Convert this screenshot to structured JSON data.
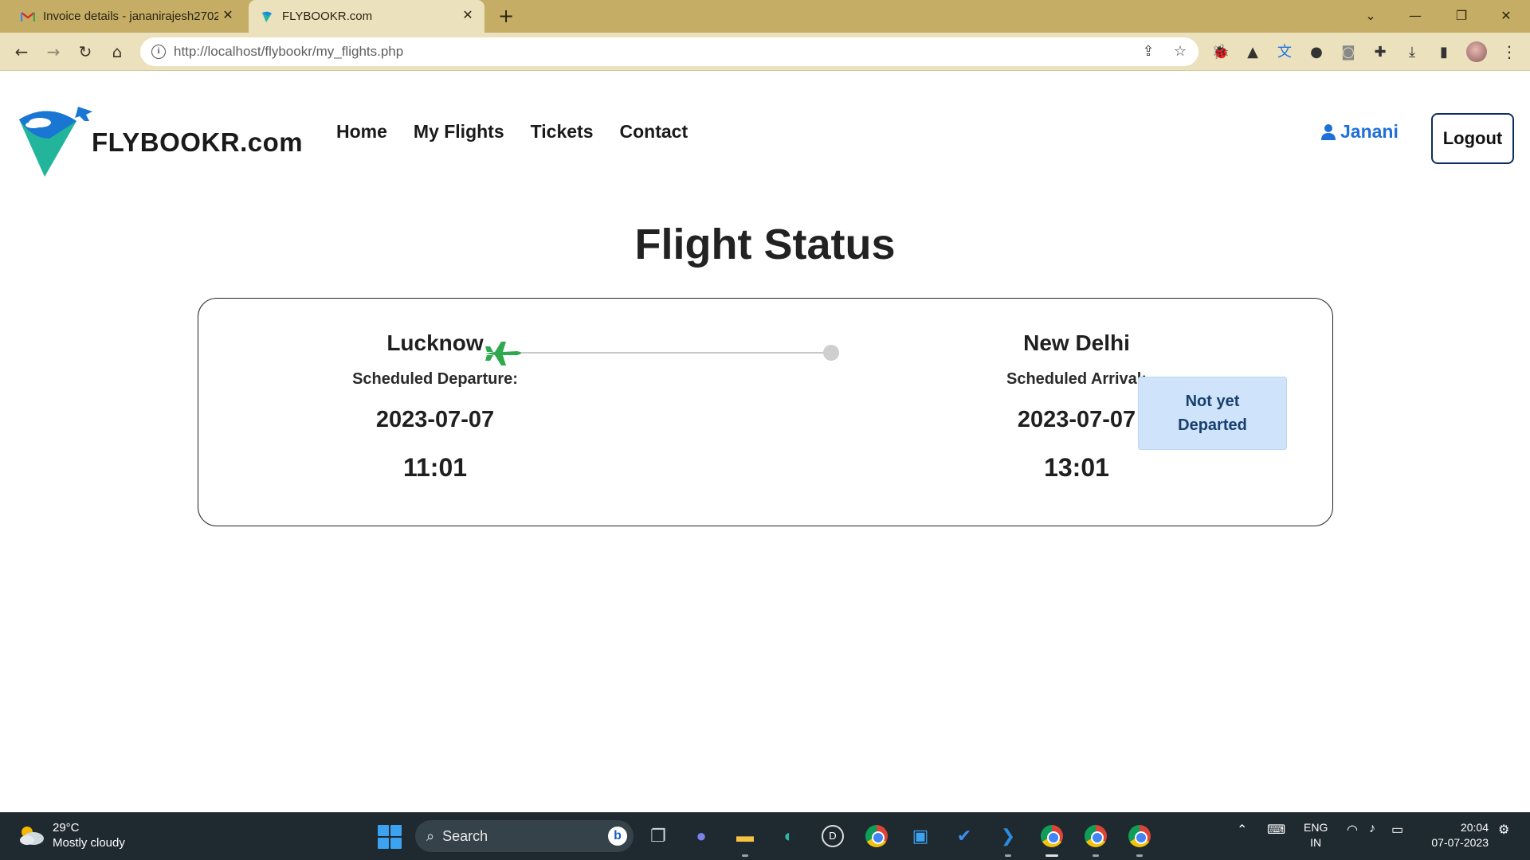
{
  "browser": {
    "tabs": [
      {
        "title": "Invoice details - jananirajesh2702",
        "icon": "gmail-icon",
        "active": false
      },
      {
        "title": "FLYBOOKR.com",
        "icon": "flybookr-favicon",
        "active": true
      }
    ],
    "new_tab_symbol": "+",
    "url": "http://localhost/flybookr/my_flights.php",
    "window_controls": {
      "dropdown": "⌄",
      "minimize": "—",
      "restore": "❐",
      "close": "✕"
    }
  },
  "site": {
    "brand": "FLYBOOKR.com",
    "nav": [
      "Home",
      "My Flights",
      "Tickets",
      "Contact"
    ],
    "user_name": "Janani",
    "logout_label": "Logout"
  },
  "page": {
    "title": "Flight Status"
  },
  "flight": {
    "departure": {
      "city": "Lucknow",
      "label": "Scheduled Departure:",
      "date": "2023-07-07",
      "time": "11:01"
    },
    "arrival": {
      "city": "New Delhi",
      "label": "Scheduled Arrival:",
      "date": "2023-07-07",
      "time": "13:01"
    },
    "status": "Not yet Departed",
    "progress": 0,
    "colors": {
      "plane": "#2fa84f",
      "status_bg": "#cfe4fa",
      "status_text": "#17406e",
      "user_link": "#1e6fd9"
    }
  },
  "taskbar": {
    "weather": {
      "temp": "29°C",
      "condition": "Mostly cloudy"
    },
    "search_placeholder": "Search",
    "language": {
      "line1": "ENG",
      "line2": "IN"
    },
    "clock": {
      "time": "20:04",
      "date": "07-07-2023"
    }
  }
}
